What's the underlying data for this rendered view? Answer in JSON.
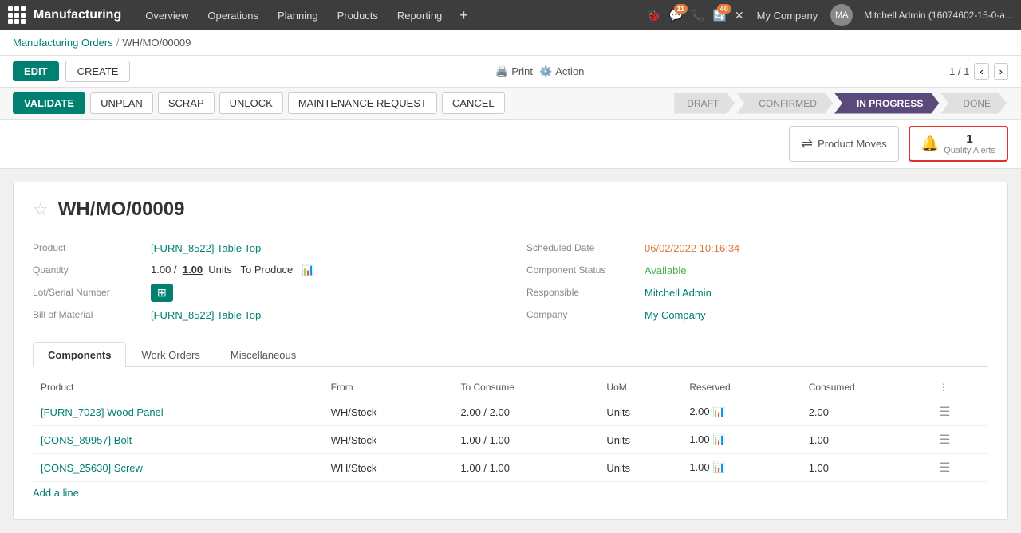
{
  "app": {
    "name": "Manufacturing",
    "nav_items": [
      "Overview",
      "Operations",
      "Planning",
      "Products",
      "Reporting"
    ],
    "nav_add": "+",
    "notifications_count": "11",
    "updates_count": "40",
    "company": "My Company",
    "user_name": "Mitchell Admin (16074602-15-0-a..."
  },
  "breadcrumb": {
    "parent": "Manufacturing Orders",
    "separator": "/",
    "current": "WH/MO/00009"
  },
  "toolbar": {
    "edit_label": "EDIT",
    "create_label": "CREATE",
    "print_label": "Print",
    "action_label": "Action",
    "pager": "1 / 1"
  },
  "status_bar": {
    "validate_label": "VALIDATE",
    "unplan_label": "UNPLAN",
    "scrap_label": "SCRAP",
    "unlock_label": "UNLOCK",
    "maintenance_request_label": "MAINTENANCE REQUEST",
    "cancel_label": "CANCEL",
    "steps": [
      {
        "label": "DRAFT",
        "active": false
      },
      {
        "label": "CONFIRMED",
        "active": false
      },
      {
        "label": "IN PROGRESS",
        "active": true
      },
      {
        "label": "DONE",
        "active": false
      }
    ]
  },
  "smart_buttons": {
    "product_moves_label": "Product Moves",
    "quality_alerts_count": "1",
    "quality_alerts_label": "Quality Alerts"
  },
  "record": {
    "title": "WH/MO/00009",
    "fields_left": [
      {
        "label": "Product",
        "value": "[FURN_8522] Table Top",
        "type": "link"
      },
      {
        "label": "Quantity",
        "value": "1.00 /  1.00  Units  To Produce",
        "type": "plain"
      },
      {
        "label": "Lot/Serial Number",
        "value": "",
        "type": "icon"
      },
      {
        "label": "Bill of Material",
        "value": "[FURN_8522] Table Top",
        "type": "link"
      }
    ],
    "fields_right": [
      {
        "label": "Scheduled Date",
        "value": "06/02/2022 10:16:34",
        "type": "orange"
      },
      {
        "label": "Component Status",
        "value": "Available",
        "type": "green"
      },
      {
        "label": "Responsible",
        "value": "Mitchell Admin",
        "type": "link"
      },
      {
        "label": "Company",
        "value": "My Company",
        "type": "link"
      }
    ],
    "tabs": [
      "Components",
      "Work Orders",
      "Miscellaneous"
    ],
    "active_tab": "Components",
    "table": {
      "columns": [
        "Product",
        "From",
        "To Consume",
        "UoM",
        "Reserved",
        "Consumed"
      ],
      "rows": [
        {
          "product": "[FURN_7023] Wood Panel",
          "from": "WH/Stock",
          "to_consume": "2.00 / 2.00",
          "uom": "Units",
          "reserved": "2.00",
          "consumed": "2.00",
          "consumed_green": true
        },
        {
          "product": "[CONS_89957] Bolt",
          "from": "WH/Stock",
          "to_consume": "1.00 / 1.00",
          "uom": "Units",
          "reserved": "1.00",
          "consumed": "1.00",
          "consumed_green": true
        },
        {
          "product": "[CONS_25630] Screw",
          "from": "WH/Stock",
          "to_consume": "1.00 / 1.00",
          "uom": "Units",
          "reserved": "1.00",
          "consumed": "1.00",
          "consumed_green": true
        }
      ],
      "add_line_label": "Add a line"
    }
  }
}
